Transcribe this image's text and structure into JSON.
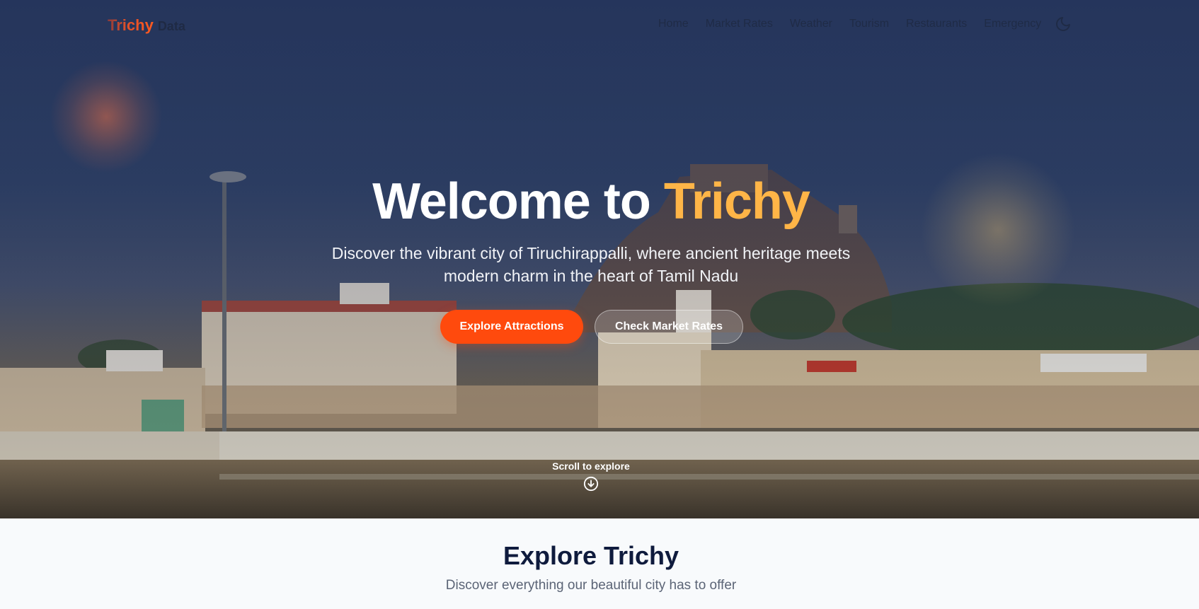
{
  "nav": {
    "logo_brand": "Trichy",
    "logo_sub": "Data",
    "links": [
      "Home",
      "Market Rates",
      "Weather",
      "Tourism",
      "Restaurants",
      "Emergency"
    ],
    "theme_icon": "moon-icon"
  },
  "hero": {
    "title_prefix": "Welcome to ",
    "title_accent": "Trichy",
    "subtitle": "Discover the vibrant city of Tiruchirappalli, where ancient heritage meets modern charm in the heart of Tamil Nadu",
    "primary_button": "Explore Attractions",
    "secondary_button": "Check Market Rates",
    "scroll_hint": "Scroll to explore",
    "scroll_icon": "arrow-down-circle-icon"
  },
  "explore": {
    "title": "Explore Trichy",
    "subtitle": "Discover everything our beautiful city has to offer"
  },
  "colors": {
    "accent_orange": "#ff4a0d",
    "accent_gold": "#ffb547",
    "heading_dark": "#0f1b3d"
  }
}
